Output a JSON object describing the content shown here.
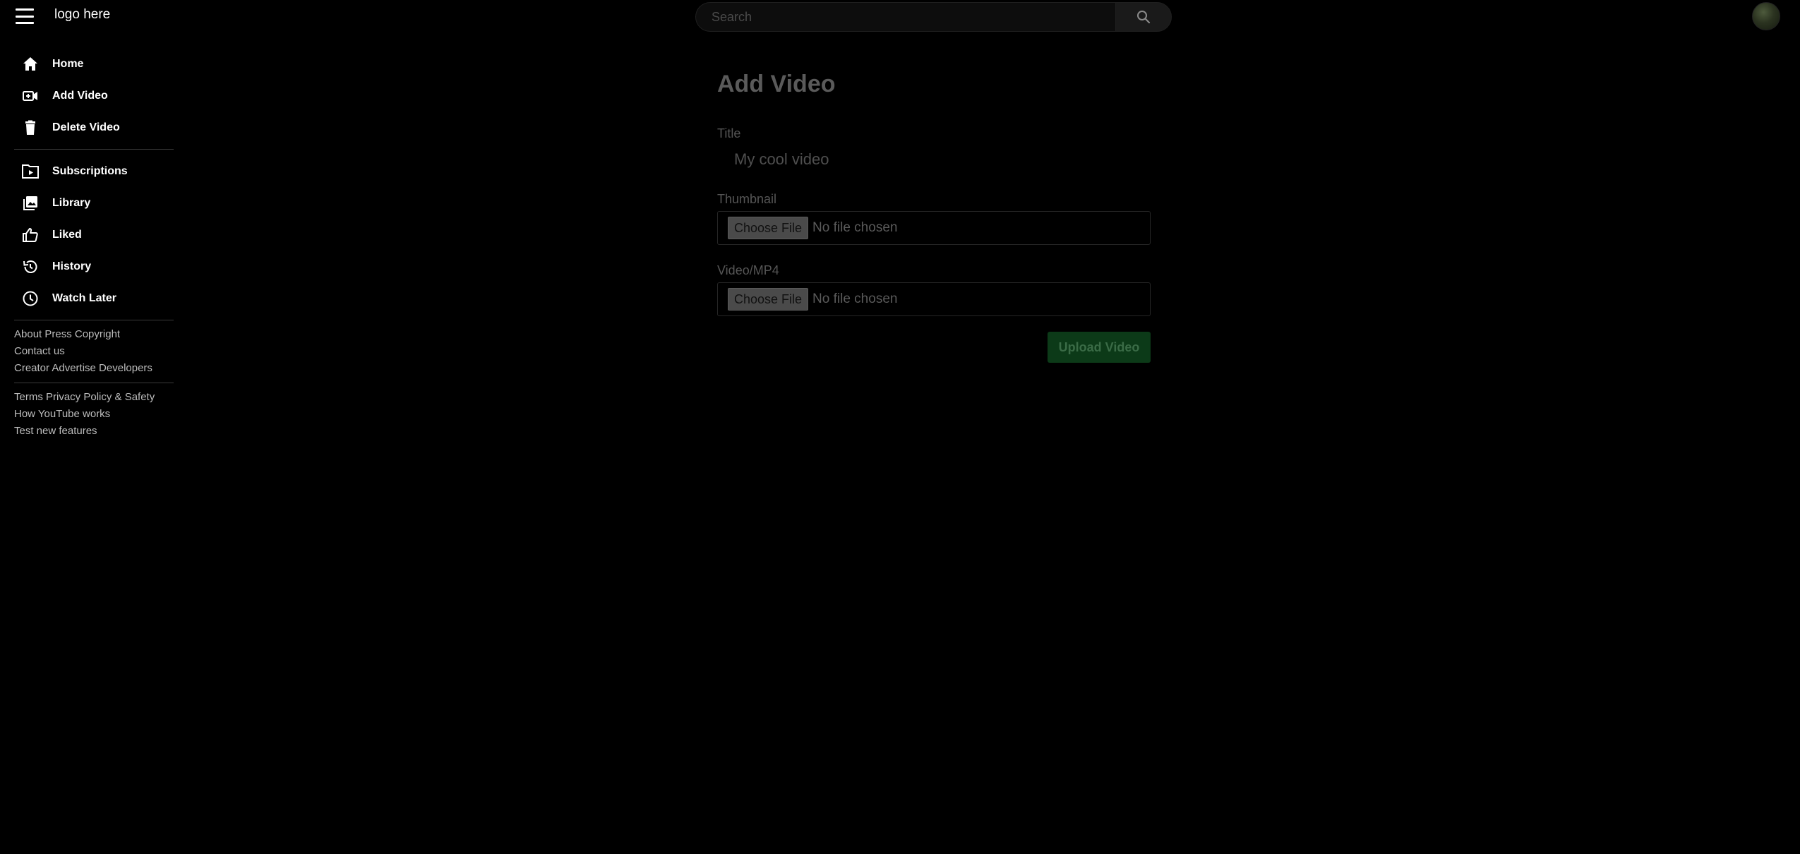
{
  "header": {
    "logo_text": "logo here",
    "search_placeholder": "Search"
  },
  "sidebar": {
    "primary": [
      {
        "label": "Home",
        "icon": "home-icon"
      },
      {
        "label": "Add Video",
        "icon": "add-video-icon"
      },
      {
        "label": "Delete Video",
        "icon": "trash-icon"
      }
    ],
    "secondary": [
      {
        "label": "Subscriptions",
        "icon": "subscriptions-icon"
      },
      {
        "label": "Library",
        "icon": "library-icon"
      },
      {
        "label": "Liked",
        "icon": "thumbs-up-icon"
      },
      {
        "label": "History",
        "icon": "history-icon"
      },
      {
        "label": "Watch Later",
        "icon": "clock-icon"
      }
    ],
    "footer_group_1": [
      "About Press Copyright",
      "Contact us",
      "Creator Advertise Developers"
    ],
    "footer_group_2": [
      "Terms Privacy Policy & Safety",
      "How YouTube works",
      "Test new features"
    ]
  },
  "form": {
    "page_title": "Add Video",
    "title_label": "Title",
    "title_placeholder": "My cool video",
    "thumbnail_label": "Thumbnail",
    "video_label": "Video/MP4",
    "choose_file_label": "Choose File",
    "no_file_text": "No file chosen",
    "upload_label": "Upload Video"
  },
  "colors": {
    "background": "#000000",
    "upload_button": "#0c3a18"
  }
}
